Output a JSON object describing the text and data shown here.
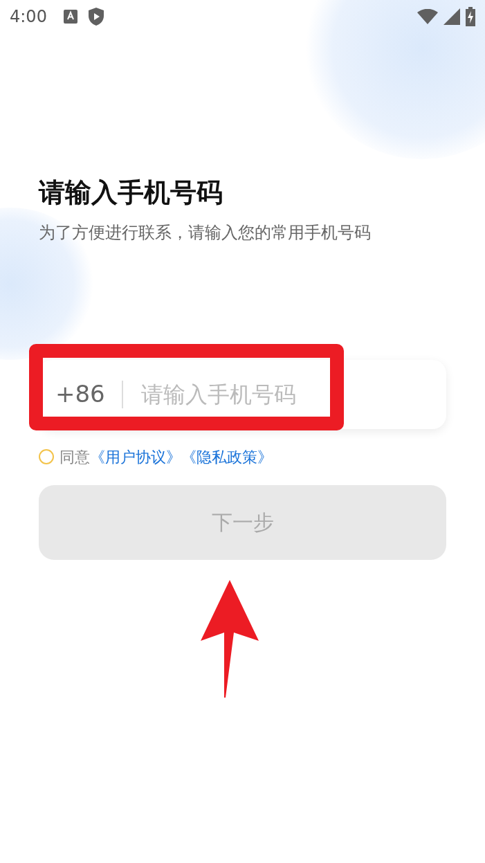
{
  "status_bar": {
    "time": "4:00"
  },
  "title": "请输入手机号码",
  "subtitle": "为了方便进行联系，请输入您的常用手机号码",
  "phone_field": {
    "country_code": "+86",
    "placeholder": "请输入手机号码"
  },
  "agreement": {
    "checked": false,
    "prefix": "同意",
    "links": [
      "《用户协议》",
      "《隐私政策》"
    ]
  },
  "next_button": {
    "label": "下一步",
    "disabled": true
  }
}
